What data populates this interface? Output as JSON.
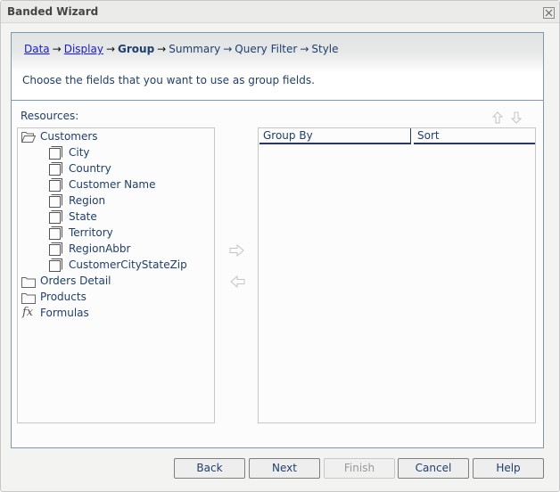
{
  "window": {
    "title": "Banded Wizard",
    "close_label": "×"
  },
  "breadcrumb": {
    "steps": [
      {
        "label": "Data",
        "state": "link"
      },
      {
        "label": "Display",
        "state": "link"
      },
      {
        "label": "Group",
        "state": "current"
      },
      {
        "label": "Summary",
        "state": "upcoming"
      },
      {
        "label": "Query Filter",
        "state": "upcoming"
      },
      {
        "label": "Style",
        "state": "upcoming"
      }
    ],
    "separator": "→"
  },
  "instruction": "Choose the fields that you want to use as group fields.",
  "resources": {
    "label": "Resources:",
    "tree": [
      {
        "label": "Customers",
        "icon": "folder-open-icon",
        "expanded": true,
        "children": [
          "City",
          "Country",
          "Customer Name",
          "Region",
          "State",
          "Territory",
          "RegionAbbr",
          "CustomerCityStateZip"
        ]
      },
      {
        "label": "Orders Detail",
        "icon": "folder-icon"
      },
      {
        "label": "Products",
        "icon": "folder-icon"
      },
      {
        "label": "Formulas",
        "icon": "formula-icon",
        "icon_text": "fx"
      }
    ]
  },
  "group_table": {
    "columns": [
      "Group By",
      "Sort"
    ],
    "rows": []
  },
  "buttons": {
    "back": "Back",
    "next": "Next",
    "finish": "Finish",
    "cancel": "Cancel",
    "help": "Help"
  }
}
